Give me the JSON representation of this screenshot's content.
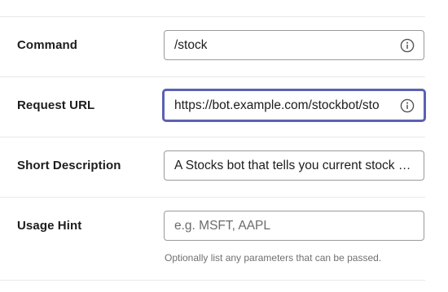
{
  "fields": {
    "command": {
      "label": "Command",
      "value": "/stock"
    },
    "request_url": {
      "label": "Request URL",
      "value": "https://bot.example.com/stockbot/sto"
    },
    "short_description": {
      "label": "Short Description",
      "value": "A Stocks bot that tells you current stock prices"
    },
    "usage_hint": {
      "label": "Usage Hint",
      "placeholder": "e.g. MSFT, AAPL",
      "help": "Optionally list any parameters that can be passed."
    }
  },
  "colors": {
    "focus_border": "#5b61b3",
    "divider": "#e8e8e8",
    "input_border": "#9a9a9a"
  }
}
